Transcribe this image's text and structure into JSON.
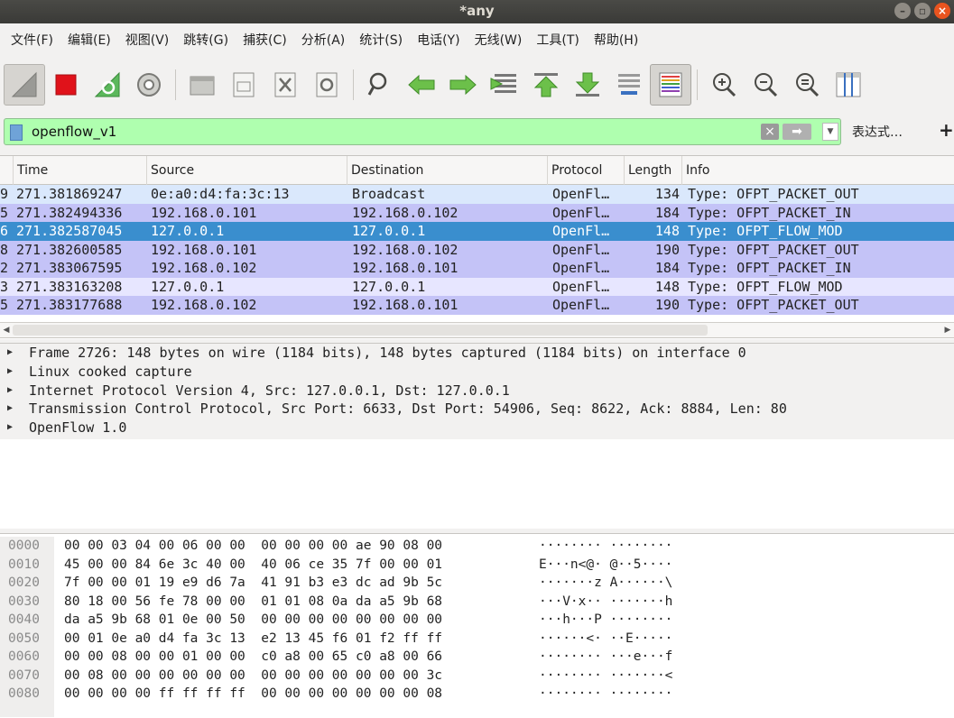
{
  "window": {
    "title": "*any"
  },
  "menu": [
    {
      "label": "文件(F)"
    },
    {
      "label": "编辑(E)"
    },
    {
      "label": "视图(V)"
    },
    {
      "label": "跳转(G)"
    },
    {
      "label": "捕获(C)"
    },
    {
      "label": "分析(A)"
    },
    {
      "label": "统计(S)"
    },
    {
      "label": "电话(Y)"
    },
    {
      "label": "无线(W)"
    },
    {
      "label": "工具(T)"
    },
    {
      "label": "帮助(H)"
    }
  ],
  "toolbar": {
    "icons": [
      "start-capture-icon",
      "stop-capture-icon",
      "restart-capture-icon",
      "capture-options-icon",
      "open-file-icon",
      "save-file-icon",
      "close-file-icon",
      "reload-file-icon",
      "find-packet-icon",
      "go-back-icon",
      "go-forward-icon",
      "go-to-packet-icon",
      "go-first-icon",
      "go-last-icon",
      "auto-scroll-icon",
      "colorize-icon",
      "zoom-in-icon",
      "zoom-out-icon",
      "zoom-normal-icon",
      "resize-columns-icon"
    ]
  },
  "filter": {
    "value": "openflow_v1",
    "expression_label": "表达式…",
    "plus_label": "+",
    "background_color": "#afffaf"
  },
  "packet_list": {
    "columns": [
      "Time",
      "Source",
      "Destination",
      "Protocol",
      "Length",
      "Info"
    ],
    "rows": [
      {
        "no": "9",
        "time": "271.381869247",
        "source": "0e:a0:d4:fa:3c:13",
        "destination": "Broadcast",
        "protocol": "OpenFl…",
        "length": "134",
        "info": "Type: OFPT_PACKET_OUT",
        "style": "light"
      },
      {
        "no": "5",
        "time": "271.382494336",
        "source": "192.168.0.101",
        "destination": "192.168.0.102",
        "protocol": "OpenFl…",
        "length": "184",
        "info": "Type: OFPT_PACKET_IN",
        "style": "purple"
      },
      {
        "no": "6",
        "time": "271.382587045",
        "source": "127.0.0.1",
        "destination": "127.0.0.1",
        "protocol": "OpenFl…",
        "length": "148",
        "info": "Type: OFPT_FLOW_MOD",
        "style": "sel"
      },
      {
        "no": "8",
        "time": "271.382600585",
        "source": "192.168.0.101",
        "destination": "192.168.0.102",
        "protocol": "OpenFl…",
        "length": "190",
        "info": "Type: OFPT_PACKET_OUT",
        "style": "purple"
      },
      {
        "no": "2",
        "time": "271.383067595",
        "source": "192.168.0.102",
        "destination": "192.168.0.101",
        "protocol": "OpenFl…",
        "length": "184",
        "info": "Type: OFPT_PACKET_IN",
        "style": "purple"
      },
      {
        "no": "3",
        "time": "271.383163208",
        "source": "127.0.0.1",
        "destination": "127.0.0.1",
        "protocol": "OpenFl…",
        "length": "148",
        "info": "Type: OFPT_FLOW_MOD",
        "style": "lav"
      },
      {
        "no": "5",
        "time": "271.383177688",
        "source": "192.168.0.102",
        "destination": "192.168.0.101",
        "protocol": "OpenFl…",
        "length": "190",
        "info": "Type: OFPT_PACKET_OUT",
        "style": "purple"
      }
    ]
  },
  "details": [
    "Frame 2726: 148 bytes on wire (1184 bits), 148 bytes captured (1184 bits) on interface 0",
    "Linux cooked capture",
    "Internet Protocol Version 4, Src: 127.0.0.1, Dst: 127.0.0.1",
    "Transmission Control Protocol, Src Port: 6633, Dst Port: 54906, Seq: 8622, Ack: 8884, Len: 80",
    "OpenFlow 1.0"
  ],
  "hex": {
    "offsets": [
      "0000",
      "0010",
      "0020",
      "0030",
      "0040",
      "0050",
      "0060",
      "0070",
      "0080"
    ],
    "bytes": [
      "00 00 03 04 00 06 00 00  00 00 00 00 ae 90 08 00",
      "45 00 00 84 6e 3c 40 00  40 06 ce 35 7f 00 00 01",
      "7f 00 00 01 19 e9 d6 7a  41 91 b3 e3 dc ad 9b 5c",
      "80 18 00 56 fe 78 00 00  01 01 08 0a da a5 9b 68",
      "da a5 9b 68 01 0e 00 50  00 00 00 00 00 00 00 00",
      "00 01 0e a0 d4 fa 3c 13  e2 13 45 f6 01 f2 ff ff",
      "00 00 08 00 00 01 00 00  c0 a8 00 65 c0 a8 00 66",
      "00 08 00 00 00 00 00 00  00 00 00 00 00 00 00 3c",
      "00 00 00 00 ff ff ff ff  00 00 00 00 00 00 00 08"
    ],
    "ascii": [
      "········ ········",
      "E···n<@· @··5····",
      "·······z A······\\",
      "···V·x·· ·······h",
      "···h···P ········",
      "······<· ··E·····",
      "········ ···e···f",
      "········ ·······<",
      "········ ········"
    ]
  }
}
